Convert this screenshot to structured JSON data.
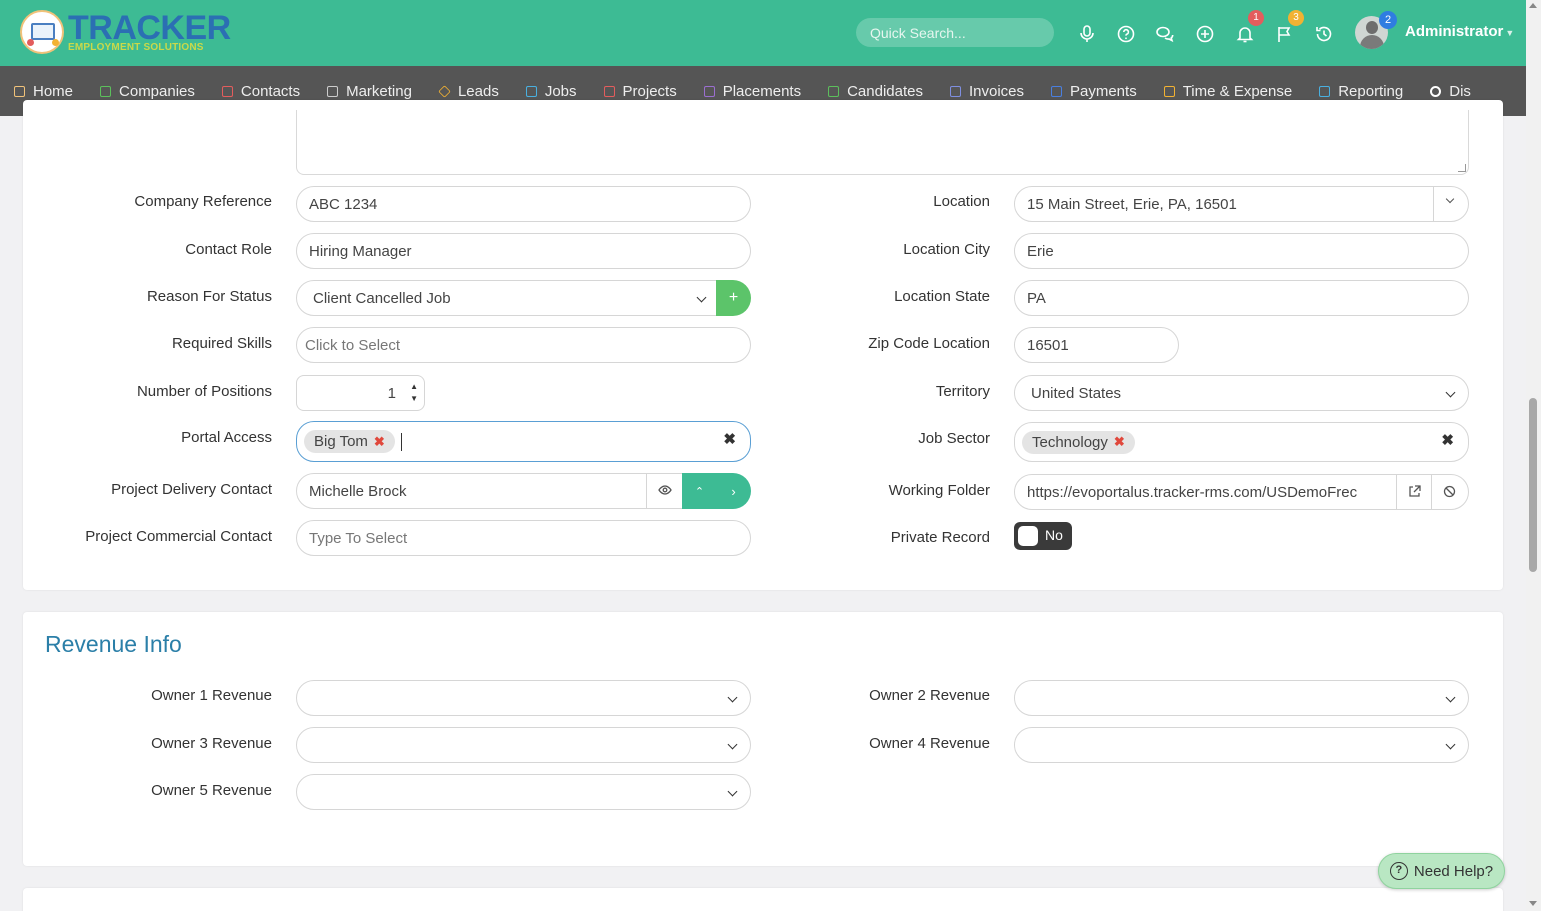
{
  "header": {
    "logo_text": "TRACKER",
    "logo_subtext": "EMPLOYMENT SOLUTIONS",
    "search_placeholder": "Quick Search...",
    "notifications_count": "1",
    "flags_count": "3",
    "avatar_badge": "2",
    "user_name": "Administrator",
    "colors": {
      "header_bg": "#3dbb94",
      "nav_bg": "#555555",
      "accent": "#3dbb94"
    }
  },
  "nav": {
    "items": [
      {
        "label": "Home",
        "icon": "home-icon",
        "color": "#f0c27a"
      },
      {
        "label": "Companies",
        "icon": "building-icon",
        "color": "#5cbf5c"
      },
      {
        "label": "Contacts",
        "icon": "contacts-icon",
        "color": "#e35d5d"
      },
      {
        "label": "Marketing",
        "icon": "broadcast-icon",
        "color": "#cccccc"
      },
      {
        "label": "Leads",
        "icon": "diamond-icon",
        "color": "#f2b233"
      },
      {
        "label": "Jobs",
        "icon": "trophy-icon",
        "color": "#4ab0e0"
      },
      {
        "label": "Projects",
        "icon": "checklist-icon",
        "color": "#e35d5d"
      },
      {
        "label": "Placements",
        "icon": "briefcase-icon",
        "color": "#9b6fd0"
      },
      {
        "label": "Candidates",
        "icon": "user-icon",
        "color": "#5cbf5c"
      },
      {
        "label": "Invoices",
        "icon": "invoice-icon",
        "color": "#7f8fe0"
      },
      {
        "label": "Payments",
        "icon": "payment-icon",
        "color": "#4a7fe0"
      },
      {
        "label": "Time & Expense",
        "icon": "clock-icon",
        "color": "#f2b233"
      },
      {
        "label": "Reporting",
        "icon": "bar-chart-icon",
        "color": "#4ab0e0"
      },
      {
        "label": "Dis",
        "icon": "search-icon",
        "color": "#ffffff"
      }
    ]
  },
  "form": {
    "company_reference": {
      "label": "Company Reference",
      "value": "ABC 1234"
    },
    "contact_role": {
      "label": "Contact Role",
      "value": "Hiring Manager"
    },
    "reason_for_status": {
      "label": "Reason For Status",
      "value": "Client Cancelled Job",
      "add_label": "+"
    },
    "required_skills": {
      "label": "Required Skills",
      "placeholder": "Click to Select"
    },
    "number_of_positions": {
      "label": "Number of Positions",
      "value": "1"
    },
    "portal_access": {
      "label": "Portal Access",
      "tag": "Big Tom"
    },
    "project_delivery_contact": {
      "label": "Project Delivery Contact",
      "value": "Michelle Brock"
    },
    "project_commercial_contact": {
      "label": "Project Commercial Contact",
      "placeholder": "Type To Select"
    },
    "location": {
      "label": "Location",
      "value": "15 Main Street, Erie, PA, 16501"
    },
    "location_city": {
      "label": "Location City",
      "value": "Erie"
    },
    "location_state": {
      "label": "Location State",
      "value": "PA"
    },
    "zip_code_location": {
      "label": "Zip Code Location",
      "value": "16501"
    },
    "territory": {
      "label": "Territory",
      "value": "United States"
    },
    "job_sector": {
      "label": "Job Sector",
      "tag": "Technology"
    },
    "working_folder": {
      "label": "Working Folder",
      "value": "https://evoportalus.tracker-rms.com/USDemoFrec"
    },
    "private_record": {
      "label": "Private Record",
      "value": "No"
    }
  },
  "revenue": {
    "title": "Revenue Info",
    "owner1_label": "Owner 1 Revenue",
    "owner2_label": "Owner 2 Revenue",
    "owner3_label": "Owner 3 Revenue",
    "owner4_label": "Owner 4 Revenue",
    "owner5_label": "Owner 5 Revenue"
  },
  "help": {
    "label": "Need Help?"
  }
}
